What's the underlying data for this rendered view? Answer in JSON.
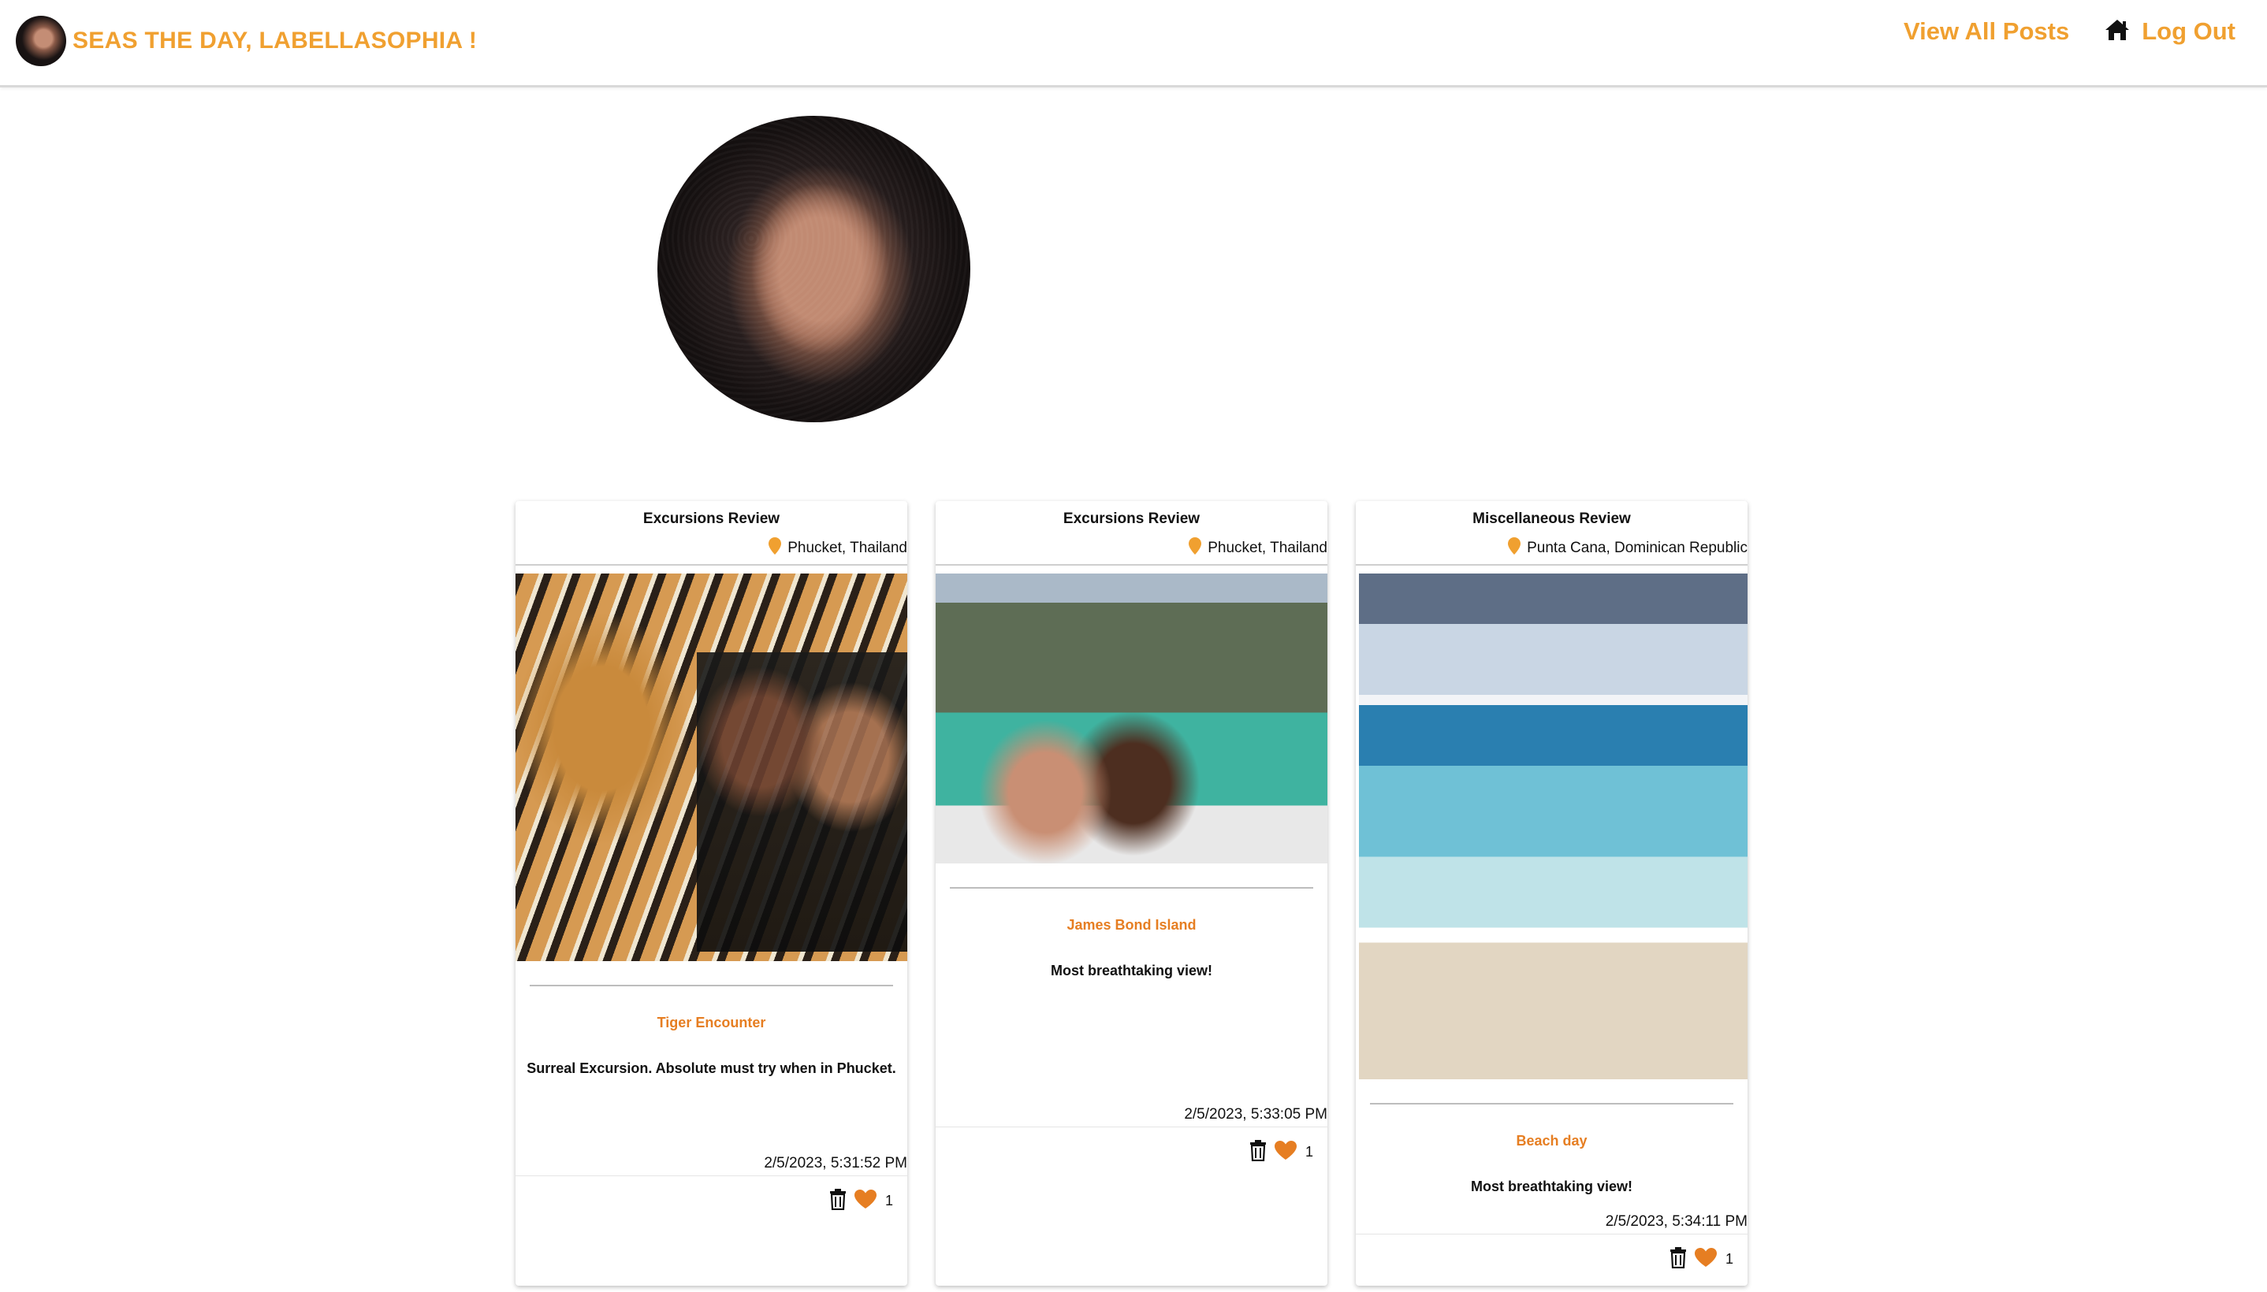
{
  "header": {
    "title": "SEAS THE DAY, LABELLASOPHIA !",
    "nav": {
      "view_all_posts": "View All Posts",
      "log_out": "Log Out"
    }
  },
  "colors": {
    "accent": "#f0a030",
    "title_orange": "#e67e22",
    "heart": "#e67e22"
  },
  "posts": [
    {
      "type": "Excursions Review",
      "location": "Phucket, Thailand",
      "title": "Tiger Encounter",
      "description": "Surreal Excursion. Absolute must try when in Phucket.",
      "date": "2/5/2023, 5:31:52 PM",
      "likes": "1"
    },
    {
      "type": "Excursions Review",
      "location": "Phucket, Thailand",
      "title": "James Bond Island",
      "description": "Most breathtaking view!",
      "date": "2/5/2023, 5:33:05 PM",
      "likes": "1"
    },
    {
      "type": "Miscellaneous Review",
      "location": "Punta Cana, Dominican Republic",
      "title": "Beach day",
      "description": "Most breathtaking view!",
      "date": "2/5/2023, 5:34:11 PM",
      "likes": "1"
    }
  ]
}
